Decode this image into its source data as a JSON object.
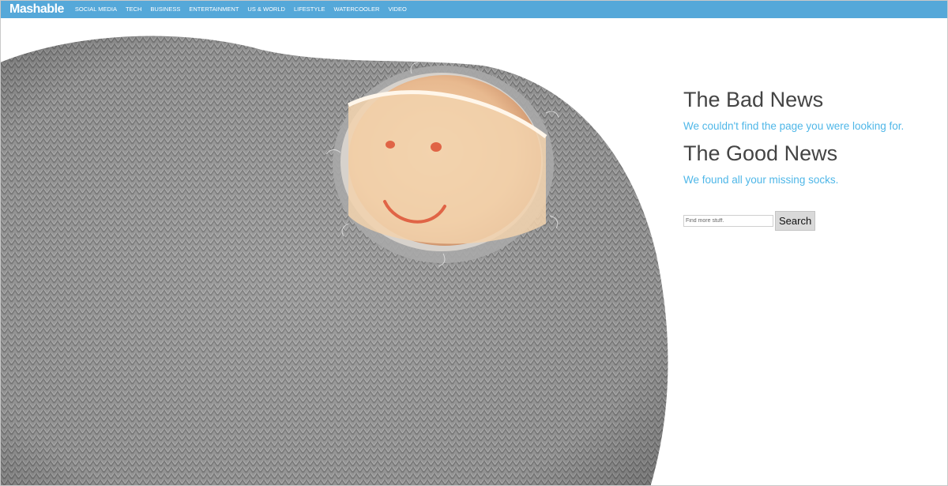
{
  "header": {
    "logo": "Mashable",
    "nav": [
      {
        "label": "SOCIAL MEDIA"
      },
      {
        "label": "TECH"
      },
      {
        "label": "BUSINESS"
      },
      {
        "label": "ENTERTAINMENT"
      },
      {
        "label": "US & WORLD"
      },
      {
        "label": "LIFESTYLE"
      },
      {
        "label": "WATERCOOLER"
      },
      {
        "label": "VIDEO"
      }
    ],
    "bar_color": "#55a8d9"
  },
  "main": {
    "bad_heading": "The Bad News",
    "bad_text": "We couldn't find the page you were looking for.",
    "good_heading": "The Good News",
    "good_text": "We found all your missing socks.",
    "heading_color": "#444444",
    "text_color": "#4fb7e8"
  },
  "search": {
    "placeholder": "Find more stuff.",
    "button_label": "Search"
  },
  "hero_image": {
    "subject": "grey-knit-sock-with-toe-hole-smiley-face-icon"
  }
}
